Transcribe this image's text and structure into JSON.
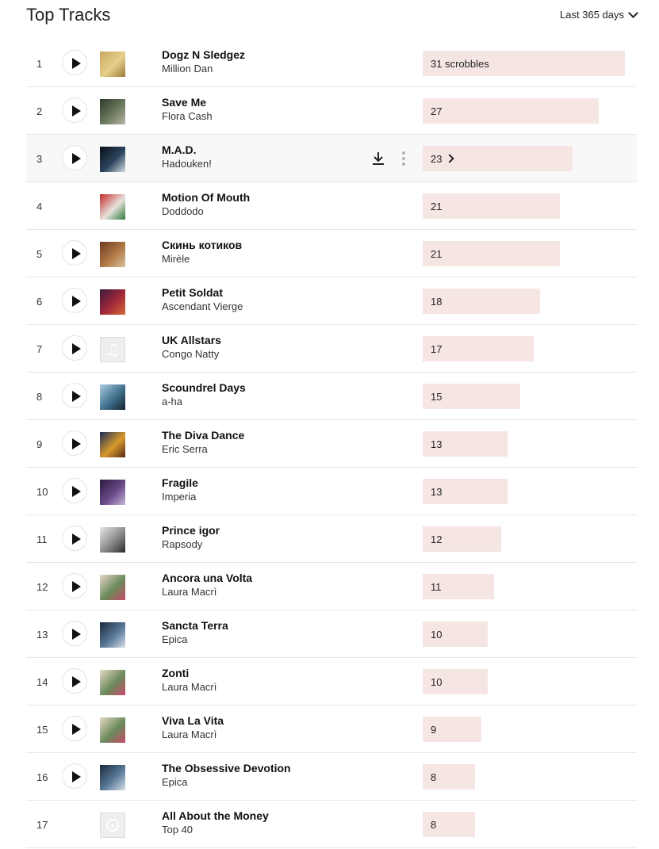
{
  "header": {
    "title": "Top Tracks",
    "period_label": "Last 365 days"
  },
  "colors": {
    "bar_fill": "#f5e6e4",
    "row_divider": "#e6e6e6",
    "hover_row": "#f8f8f8"
  },
  "scrobble_unit": "scrobbles",
  "tracks": [
    {
      "rank": "1",
      "name": "Dogz N Sledgez",
      "artist": "Million Dan",
      "scrobbles": 31,
      "label": "31 scrobbles",
      "play": true,
      "art": [
        "#c8a860",
        "#e6cf8a",
        "#9c7a35"
      ]
    },
    {
      "rank": "2",
      "name": "Save Me",
      "artist": "Flora Cash",
      "scrobbles": 27,
      "label": "27",
      "play": true,
      "art": [
        "#2d3a2c",
        "#6c7a5e",
        "#b9b7a9"
      ]
    },
    {
      "rank": "3",
      "name": "M.A.D.",
      "artist": "Hadouken!",
      "scrobbles": 23,
      "label": "23",
      "play": true,
      "hover": true,
      "art": [
        "#0b0f14",
        "#2c4660",
        "#d8dde3"
      ]
    },
    {
      "rank": "4",
      "name": "Motion Of Mouth",
      "artist": "Doddodo",
      "scrobbles": 21,
      "label": "21",
      "play": false,
      "art": [
        "#c42a2a",
        "#e7e2dc",
        "#2e7a3a"
      ]
    },
    {
      "rank": "5",
      "name": "Скинь котиков",
      "artist": "Mirèle",
      "scrobbles": 21,
      "label": "21",
      "play": true,
      "art": [
        "#6e3a22",
        "#b07a46",
        "#d8c2a0"
      ]
    },
    {
      "rank": "6",
      "name": "Petit Soldat",
      "artist": "Ascendant Vierge",
      "scrobbles": 18,
      "label": "18",
      "play": true,
      "art": [
        "#3a1a3e",
        "#a42a3a",
        "#d86a34"
      ]
    },
    {
      "rank": "7",
      "name": "UK Allstars",
      "artist": "Congo Natty",
      "scrobbles": 17,
      "label": "17",
      "play": true,
      "art": "note"
    },
    {
      "rank": "8",
      "name": "Scoundrel Days",
      "artist": "a-ha",
      "scrobbles": 15,
      "label": "15",
      "play": true,
      "art": [
        "#a9cde0",
        "#3f6f8c",
        "#16222c"
      ]
    },
    {
      "rank": "9",
      "name": "The Diva Dance",
      "artist": "Eric Serra",
      "scrobbles": 13,
      "label": "13",
      "play": true,
      "art": [
        "#1c2a5a",
        "#d89a2a",
        "#5a2a1a"
      ]
    },
    {
      "rank": "10",
      "name": "Fragile",
      "artist": "Imperia",
      "scrobbles": 13,
      "label": "13",
      "play": true,
      "art": [
        "#2a1a3a",
        "#6a4a8a",
        "#c8b8d8"
      ]
    },
    {
      "rank": "11",
      "name": "Prince igor",
      "artist": "Rapsody",
      "scrobbles": 12,
      "label": "12",
      "play": true,
      "art": [
        "#e8e8e8",
        "#8a8a8a",
        "#2a2a2a"
      ]
    },
    {
      "rank": "12",
      "name": "Ancora una Volta",
      "artist": "Laura Macrì",
      "scrobbles": 11,
      "label": "11",
      "play": true,
      "art": [
        "#e8d8c8",
        "#6a8a5a",
        "#c84a6a"
      ]
    },
    {
      "rank": "13",
      "name": "Sancta Terra",
      "artist": "Epica",
      "scrobbles": 10,
      "label": "10",
      "play": true,
      "art": [
        "#1a2a3a",
        "#5a7a9a",
        "#d8e0e8"
      ]
    },
    {
      "rank": "14",
      "name": "Zonti",
      "artist": "Laura Macrì",
      "scrobbles": 10,
      "label": "10",
      "play": true,
      "art": [
        "#e8d8c8",
        "#6a8a5a",
        "#c84a6a"
      ]
    },
    {
      "rank": "15",
      "name": "Viva La Vita",
      "artist": "Laura Macrì",
      "scrobbles": 9,
      "label": "9",
      "play": true,
      "art": [
        "#e8d8c8",
        "#6a8a5a",
        "#c84a6a"
      ]
    },
    {
      "rank": "16",
      "name": "The Obsessive Devotion",
      "artist": "Epica",
      "scrobbles": 8,
      "label": "8",
      "play": true,
      "art": [
        "#1a2a3a",
        "#5a7a9a",
        "#d8e0e8"
      ]
    },
    {
      "rank": "17",
      "name": "All About the Money",
      "artist": "Top 40",
      "scrobbles": 8,
      "label": "8",
      "play": false,
      "art": "disc"
    }
  ]
}
